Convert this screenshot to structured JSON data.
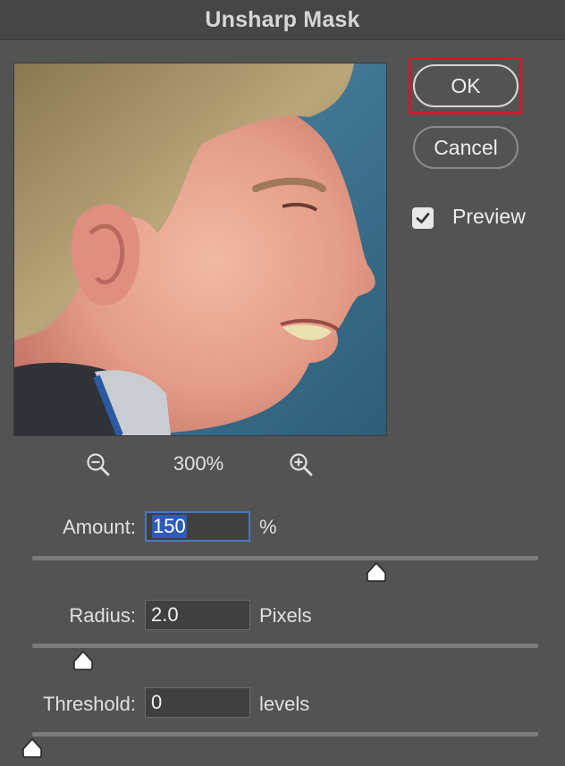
{
  "dialog": {
    "title": "Unsharp Mask"
  },
  "buttons": {
    "ok_label": "OK",
    "cancel_label": "Cancel"
  },
  "preview": {
    "label": "Preview",
    "checked": true
  },
  "zoom": {
    "level": "300%",
    "zoom_out_icon": "zoom-out-icon",
    "zoom_in_icon": "zoom-in-icon"
  },
  "params": {
    "amount": {
      "label": "Amount:",
      "value": "150",
      "unit": "%",
      "slider_fraction": 0.68
    },
    "radius": {
      "label": "Radius:",
      "value": "2.0",
      "unit": "Pixels",
      "slider_fraction": 0.1
    },
    "threshold": {
      "label": "Threshold:",
      "value": "0",
      "unit": "levels",
      "slider_fraction": 0.0
    }
  },
  "colors": {
    "background": "#535353",
    "highlight": "#d0192d",
    "selection": "#2d5bb8"
  }
}
